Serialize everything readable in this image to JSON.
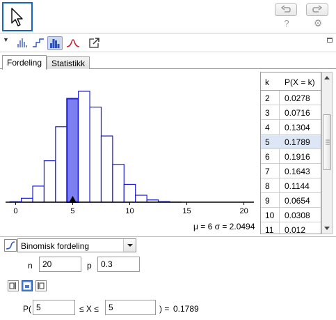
{
  "colors": {
    "accent": "#1565c0",
    "bar_fill": "#7b7ff0",
    "bar_stroke": "#1a1ad6",
    "selected_row": "#dde6f5"
  },
  "toolbar": {
    "move_tool_icon": "cursor-arrow-icon",
    "undo_icon": "undo-icon",
    "redo_icon": "redo-icon",
    "help_label": "?",
    "settings_icon": "gear-icon"
  },
  "view_toolbar": {
    "buttons": [
      "bar-chart-lines-icon",
      "step-chart-icon",
      "histogram-icon",
      "normal-curve-icon",
      "export-icon"
    ],
    "selected": "histogram-icon"
  },
  "tabs": [
    {
      "label": "Fordeling",
      "active": true
    },
    {
      "label": "Statistikk",
      "active": false
    }
  ],
  "chart_data": {
    "type": "bar",
    "title": "",
    "xlabel": "",
    "ylabel": "",
    "categories": [
      0,
      1,
      2,
      3,
      4,
      5,
      6,
      7,
      8,
      9,
      10,
      11,
      12,
      13,
      14,
      15,
      16,
      17,
      18,
      19,
      20
    ],
    "values": [
      0.0008,
      0.0068,
      0.0278,
      0.0716,
      0.1304,
      0.1789,
      0.1916,
      0.1643,
      0.1144,
      0.0654,
      0.0308,
      0.012,
      0.0039,
      0.001,
      0.0002,
      0.0,
      0.0,
      0.0,
      0.0,
      0.0,
      0.0
    ],
    "highlight_index": 5,
    "xlim": [
      -1,
      21
    ],
    "x_ticks": [
      0,
      5,
      10,
      15,
      20
    ],
    "ylim": [
      0,
      0.2
    ],
    "grid": false,
    "mean_marker": 5
  },
  "stats": {
    "text": "μ = 6   σ = 2.0494"
  },
  "table": {
    "headers": [
      "k",
      "P(X = k)"
    ],
    "rows": [
      {
        "k": "2",
        "p": "0.0278"
      },
      {
        "k": "3",
        "p": "0.0716"
      },
      {
        "k": "4",
        "p": "0.1304"
      },
      {
        "k": "5",
        "p": "0.1789"
      },
      {
        "k": "6",
        "p": "0.1916"
      },
      {
        "k": "7",
        "p": "0.1643"
      },
      {
        "k": "8",
        "p": "0.1144"
      },
      {
        "k": "9",
        "p": "0.0654"
      },
      {
        "k": "10",
        "p": "0.0308"
      },
      {
        "k": "11",
        "p": "0.012"
      }
    ],
    "selected_k": "5"
  },
  "distribution": {
    "selected": "Binomisk fordeling",
    "n_label": "n",
    "n_value": "20",
    "p_label": "p",
    "p_value": "0.3"
  },
  "probability": {
    "prefix": "P(",
    "lower": "5",
    "middle": "≤ X ≤",
    "upper": "5",
    "suffix": ") =",
    "result": "0.1789"
  }
}
